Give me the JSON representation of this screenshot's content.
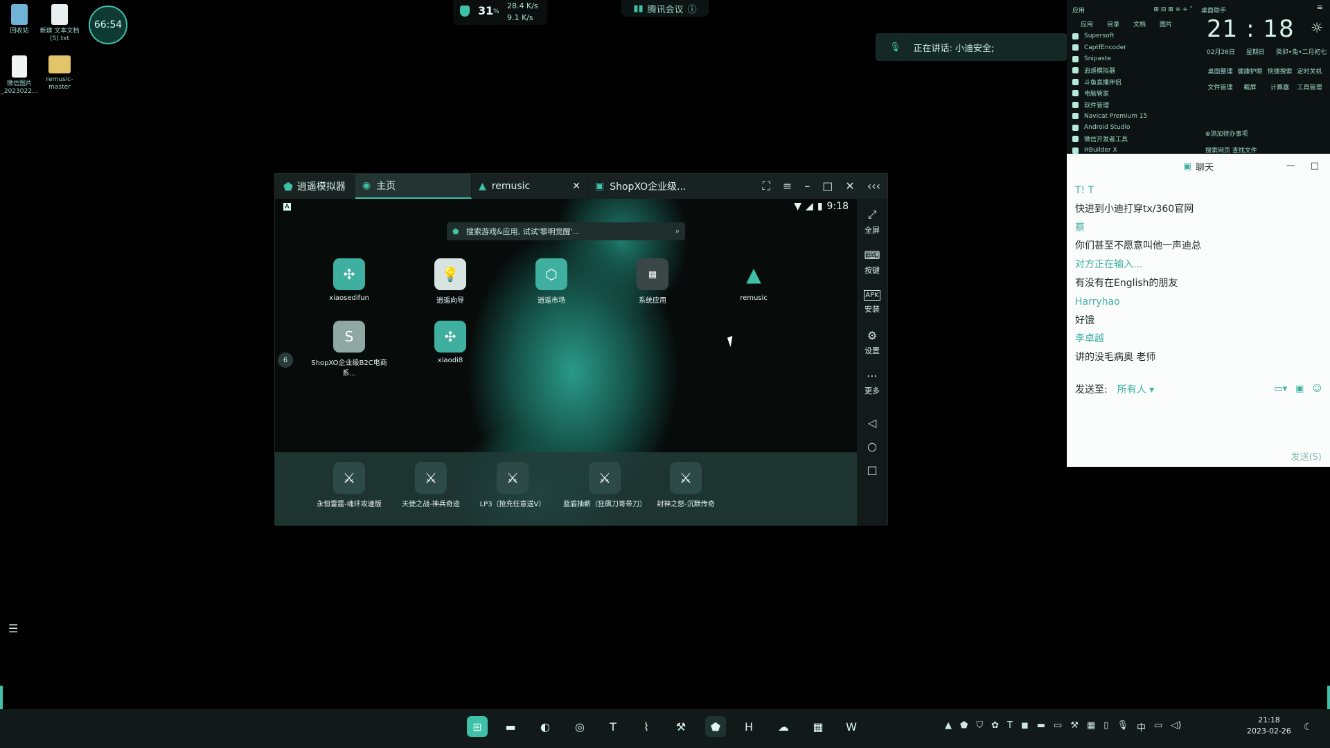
{
  "desktop": {
    "icons": [
      {
        "label": "回收站",
        "icon": "recycle-bin-icon"
      },
      {
        "label": "新建 文本文档 (5).txt",
        "icon": "text-file-icon"
      },
      {
        "label": "微信图片_2023022...",
        "icon": "image-file-icon"
      },
      {
        "label": "remusic-master",
        "icon": "folder-icon"
      }
    ],
    "timer": "66:54"
  },
  "top_widget": {
    "temp": "31",
    "temp_unit": "%",
    "upload": "28.4 K/s",
    "download": "9.1 K/s"
  },
  "meeting_pill": {
    "label": "腾讯会议",
    "icon": "info-icon"
  },
  "speaking_bar": {
    "text": "正在讲话: 小迪安全;"
  },
  "emulator": {
    "brand": "逍遥模拟器",
    "tabs": [
      {
        "label": "主页",
        "active": true
      },
      {
        "label": "remusic",
        "active": false
      },
      {
        "label": "ShopXO企业级...",
        "active": false
      }
    ],
    "status_time": "9:18",
    "search_placeholder": "搜索游戏&应用, 试试'黎明觉醒'...",
    "page_badge": "6",
    "apps": [
      {
        "label": "xiaosedifun"
      },
      {
        "label": "逍遥向导"
      },
      {
        "label": "逍遥市场"
      },
      {
        "label": "系统应用"
      },
      {
        "label": "remusic"
      },
      {
        "label": "ShopXO企业级B2C电商系..."
      },
      {
        "label": "xiaodi8"
      }
    ],
    "dock": [
      {
        "label": "永恒雷霆-魂环攻速版"
      },
      {
        "label": "天使之战-神兵奇迹"
      },
      {
        "label": "LP3（抢充任意送V）"
      },
      {
        "label": "蓝盾抽薪（狂飙刀哥带刀）"
      },
      {
        "label": "封神之怒-沉默传奇"
      }
    ],
    "side": [
      {
        "label": "全屏",
        "icon": "fullscreen-icon"
      },
      {
        "label": "按键",
        "icon": "keyboard-icon"
      },
      {
        "label": "安装",
        "icon": "apk-icon"
      },
      {
        "label": "设置",
        "icon": "gear-icon"
      },
      {
        "label": "更多",
        "icon": "more-icon"
      }
    ]
  },
  "apps_panel": {
    "title": "应用",
    "subtabs": [
      "应用",
      "目录",
      "文档",
      "图片"
    ],
    "items": [
      "Supersoft",
      "CaptfEncoder",
      "Snipaste",
      "逍遥模拟器",
      "斗鱼直播伴侣",
      "电脑管家",
      "软件管理",
      "Navicat Premium 15",
      "Android Studio",
      "微信开发者工具",
      "HBuilder X"
    ]
  },
  "clock_panel": {
    "title": "桌面助手",
    "time": "21 : 18",
    "date": "02月26日",
    "weekday": "星期日",
    "lunar": "癸卯•兔•二月初七",
    "shortcuts": [
      "桌面整理",
      "健康护眼",
      "快捷搜索",
      "定时关机",
      "文件管理",
      "截屏",
      "计算器",
      "工具管理"
    ],
    "add_todo": "添加待办事项",
    "search": "搜索网页   查找文件"
  },
  "chat": {
    "title": "聊天",
    "messages": [
      {
        "who": "T! T",
        "text": "快进到小迪打穿tx/360官网"
      },
      {
        "who": "蔡",
        "text": "你们甚至不愿意叫他一声迪总"
      },
      {
        "who": "对方正在输入...",
        "text": "有没有在English的朋友"
      },
      {
        "who": "Harryhao",
        "text": "好饿"
      },
      {
        "who": "李卓越",
        "text": "讲的没毛病奥 老师"
      }
    ],
    "send_to_label": "发送至:",
    "send_to_value": "所有人",
    "send_button": "发送(S)"
  },
  "taskbar": {
    "clock_time": "21:18",
    "clock_date": "2023-02-26",
    "ime": "中"
  }
}
